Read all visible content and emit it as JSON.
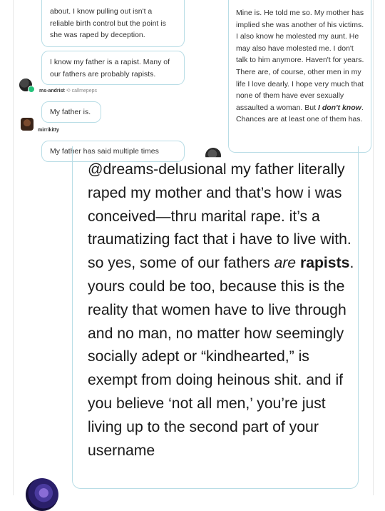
{
  "thread": {
    "left_column": {
      "bubble_a_text": "about. I know pulling out isn't a reliable birth control but the point is she was raped by deception.",
      "bubble_b_text": "I know my father is a rapist. Many of our fathers are probably rapists.",
      "user1": {
        "name": "ms-andrist",
        "reblog_icon": "⟲",
        "reblog_from": "callmepeps"
      },
      "bubble_c_text": "My father is.",
      "user2": {
        "name": "mirrikitty"
      },
      "bubble_d_text": "My father has said multiple times"
    },
    "right_column": {
      "bubble_part1": "Mine is. He told me so. My mother has implied she was another of his victims. I also know he molested my aunt. He may also have molested me. I don't talk to him anymore. Haven't for years. There are, of course, other men in my life I love dearly. I hope very much that none of them have ever sexually assaulted a woman. But ",
      "bubble_emph": "I don't know",
      "bubble_part2": ". Chances are at least one of them has."
    }
  },
  "main_post": {
    "mention": "@dreams-delusional",
    "text_part1": " my father literally raped my mother and that’s how i was conceived—thru marital rape. it’s a traumatizing fact that i have to live with. so yes, some of our fathers ",
    "emph": "are",
    "space": " ",
    "bold": "rapists",
    "text_part2": ". yours could be too, because this is the reality that women have to live through and no man, no matter how seemingly socially adept or “kindhearted,” is exempt from doing heinous shit. and if you believe ‘not all men,’ you’re just living up to the second part of your username"
  },
  "colors": {
    "bubble_border": "#b9dde6",
    "online_badge": "#24c27a"
  }
}
